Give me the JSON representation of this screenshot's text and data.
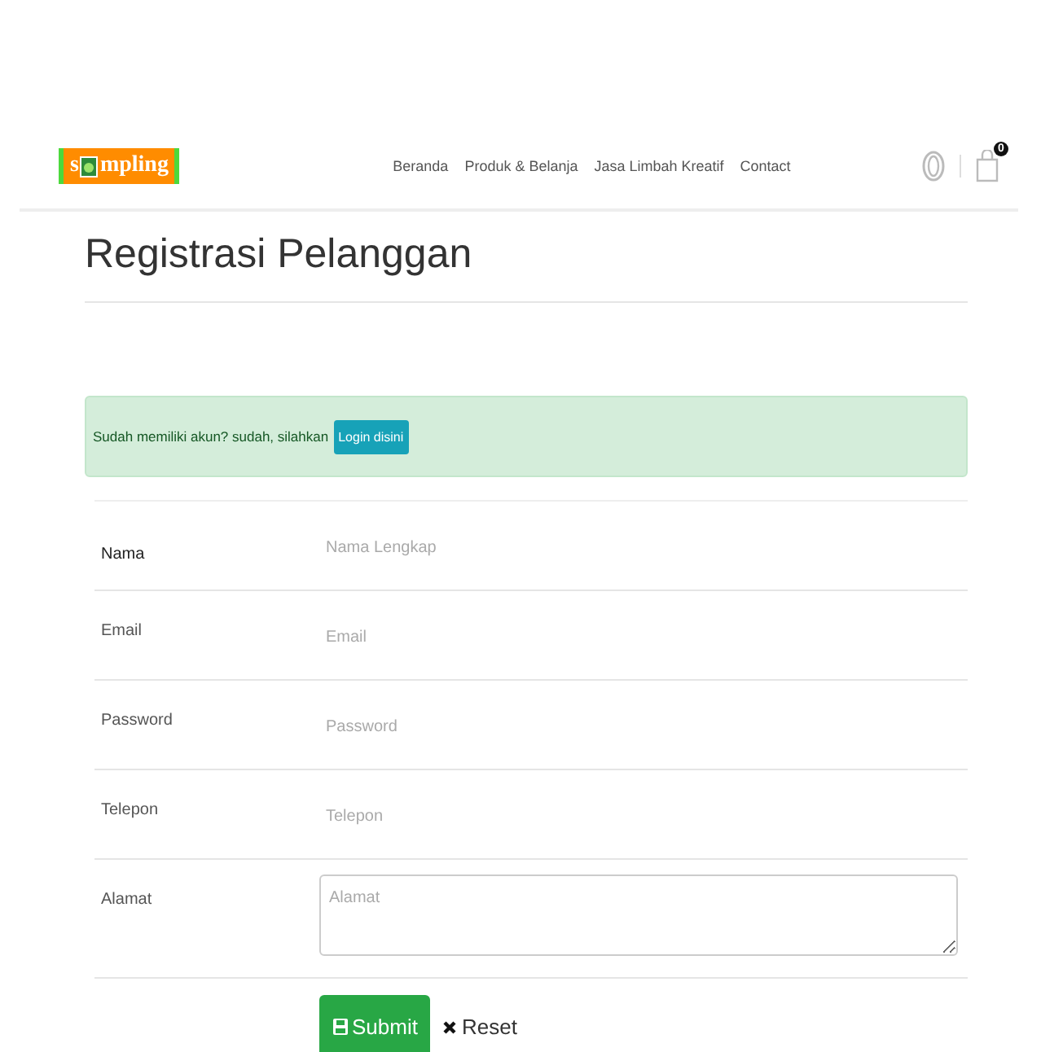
{
  "header": {
    "logo": {
      "before": "s",
      "after": "mpling"
    },
    "nav": [
      {
        "label": "Beranda"
      },
      {
        "label": "Produk & Belanja"
      },
      {
        "label": "Jasa Limbah Kreatif"
      },
      {
        "label": "Contact"
      }
    ],
    "cart_count": "0"
  },
  "title": "Registrasi Pelanggan",
  "alert": {
    "text": "Sudah memiliki akun? sudah, silahkan",
    "button": "Login disini"
  },
  "fields": [
    {
      "label": "Nama",
      "placeholder": "Nama Lengkap",
      "kind": "input",
      "strong": true
    },
    {
      "label": "Email",
      "placeholder": "Email",
      "kind": "input",
      "strong": false
    },
    {
      "label": "Password",
      "placeholder": "Password",
      "kind": "input",
      "strong": false
    },
    {
      "label": "Telepon",
      "placeholder": "Telepon",
      "kind": "input",
      "strong": false
    },
    {
      "label": "Alamat",
      "placeholder": "Alamat",
      "kind": "textarea",
      "strong": false
    }
  ],
  "buttons": {
    "submit": "Submit",
    "reset": "Reset"
  }
}
